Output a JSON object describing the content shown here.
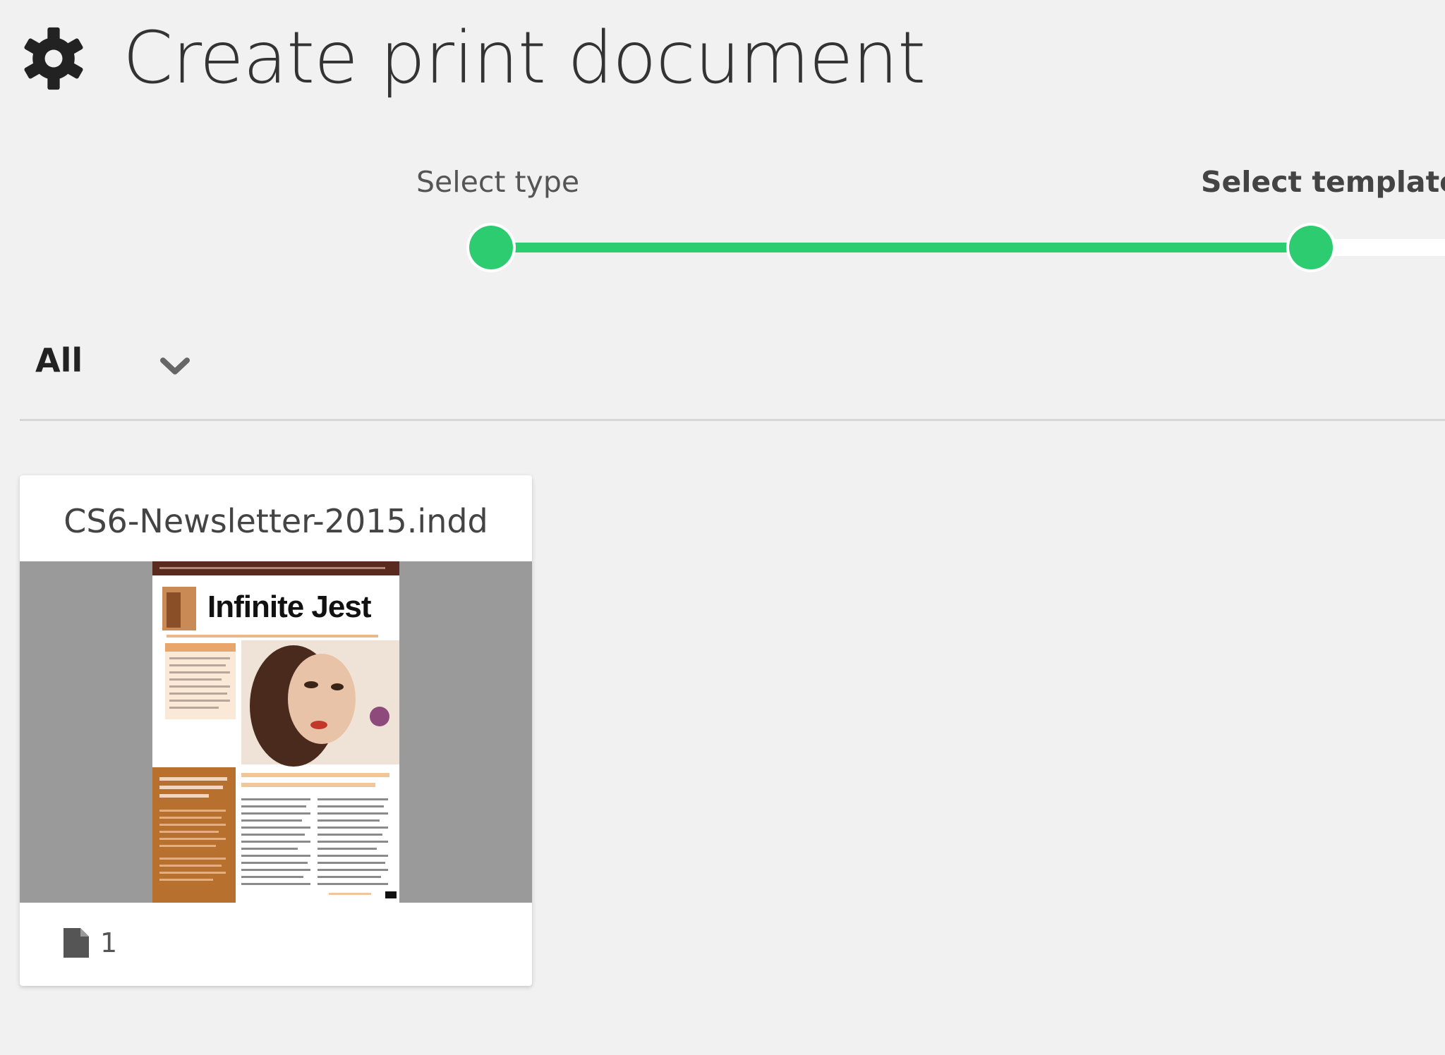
{
  "header": {
    "title": "Create print document",
    "icon": "gear-icon"
  },
  "steps": [
    {
      "label": "Select type",
      "active": false,
      "completed": true
    },
    {
      "label": "Select template",
      "active": true,
      "completed": true
    }
  ],
  "filter": {
    "selected": "All",
    "icon": "chevron-down-icon"
  },
  "templates": [
    {
      "filename": "CS6-Newsletter-2015.indd",
      "thumbnail": {
        "brand": "Infinite Jest"
      },
      "page_count": "1",
      "page_icon": "page-icon"
    }
  ],
  "colors": {
    "accent": "#2ecc71",
    "background": "#f1f1f1",
    "newsletter_orange": "#b8702f"
  }
}
